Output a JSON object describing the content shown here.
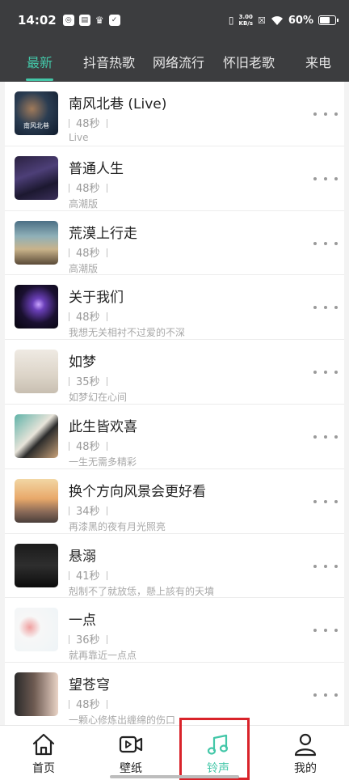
{
  "status_bar": {
    "time": "14:02",
    "net_speed_value": "3.00",
    "net_speed_unit": "KB/s",
    "battery": "60%"
  },
  "tabs": [
    {
      "label": "最新",
      "active": true
    },
    {
      "label": "抖音热歌",
      "active": false
    },
    {
      "label": "网络流行",
      "active": false
    },
    {
      "label": "怀旧老歌",
      "active": false
    },
    {
      "label": "来电",
      "active": false
    }
  ],
  "songs": [
    {
      "title": "南风北巷 (Live)",
      "duration": "48秒",
      "desc": "Live",
      "cover_text": "南风北巷"
    },
    {
      "title": "普通人生",
      "duration": "48秒",
      "desc": "高潮版",
      "cover_text": ""
    },
    {
      "title": "荒漠上行走",
      "duration": "48秒",
      "desc": "高潮版",
      "cover_text": ""
    },
    {
      "title": "关于我们",
      "duration": "48秒",
      "desc": "我想无关相衬不过爱的不深",
      "cover_text": ""
    },
    {
      "title": "如梦",
      "duration": "35秒",
      "desc": "如梦幻在心间",
      "cover_text": ""
    },
    {
      "title": "此生皆欢喜",
      "duration": "48秒",
      "desc": "一生无需多精彩",
      "cover_text": ""
    },
    {
      "title": "换个方向风景会更好看",
      "duration": "34秒",
      "desc": "再漆黑的夜有月光照亮",
      "cover_text": ""
    },
    {
      "title": "悬溺",
      "duration": "41秒",
      "desc": "剋制不了就放恁，懸上該有的天墳",
      "cover_text": ""
    },
    {
      "title": "一点",
      "duration": "36秒",
      "desc": "就再靠近一点点",
      "cover_text": ""
    },
    {
      "title": "望苍穹",
      "duration": "48秒",
      "desc": "一颗心修炼出缠绵的伤口",
      "cover_text": ""
    }
  ],
  "bottom_nav": [
    {
      "label": "首页",
      "icon": "home-icon",
      "active": false
    },
    {
      "label": "壁纸",
      "icon": "video-icon",
      "active": false
    },
    {
      "label": "铃声",
      "icon": "music-note-icon",
      "active": true
    },
    {
      "label": "我的",
      "icon": "user-icon",
      "active": false
    }
  ],
  "colors": {
    "accent": "#43c7a8",
    "header_bg": "#3c3d3f",
    "highlight": "#d9232a"
  }
}
